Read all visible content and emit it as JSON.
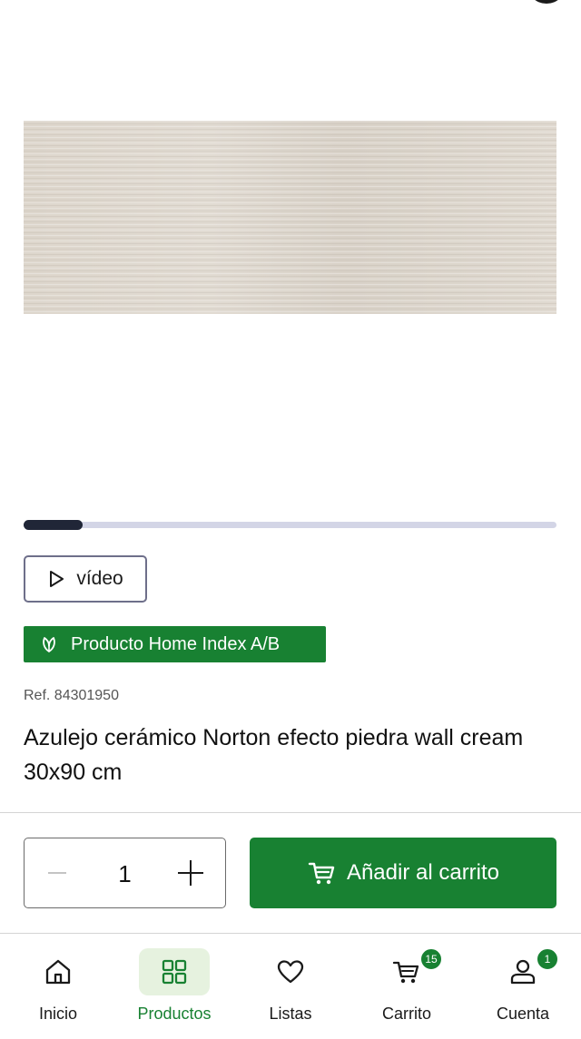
{
  "gallery": {
    "progress": 0.11
  },
  "video": {
    "label": "vídeo"
  },
  "badge": {
    "label": "Producto Home Index A/B"
  },
  "product": {
    "ref": "Ref. 84301950",
    "title": "Azulejo cerámico Norton efecto piedra wall cream 30x90 cm"
  },
  "quantity": {
    "value": "1"
  },
  "cart_button": {
    "label": "Añadir al carrito"
  },
  "nav": {
    "items": [
      {
        "label": "Inicio",
        "icon": "home-icon",
        "active": false
      },
      {
        "label": "Productos",
        "icon": "grid-icon",
        "active": true
      },
      {
        "label": "Listas",
        "icon": "heart-icon",
        "active": false
      },
      {
        "label": "Carrito",
        "icon": "cart-icon",
        "active": false,
        "badge": "15"
      },
      {
        "label": "Cuenta",
        "icon": "user-icon",
        "active": false,
        "badge": "1"
      }
    ]
  },
  "colors": {
    "brand_green": "#188132",
    "active_bg": "#e6f2df",
    "track": "#d3d5e6",
    "thumb": "#202637"
  }
}
